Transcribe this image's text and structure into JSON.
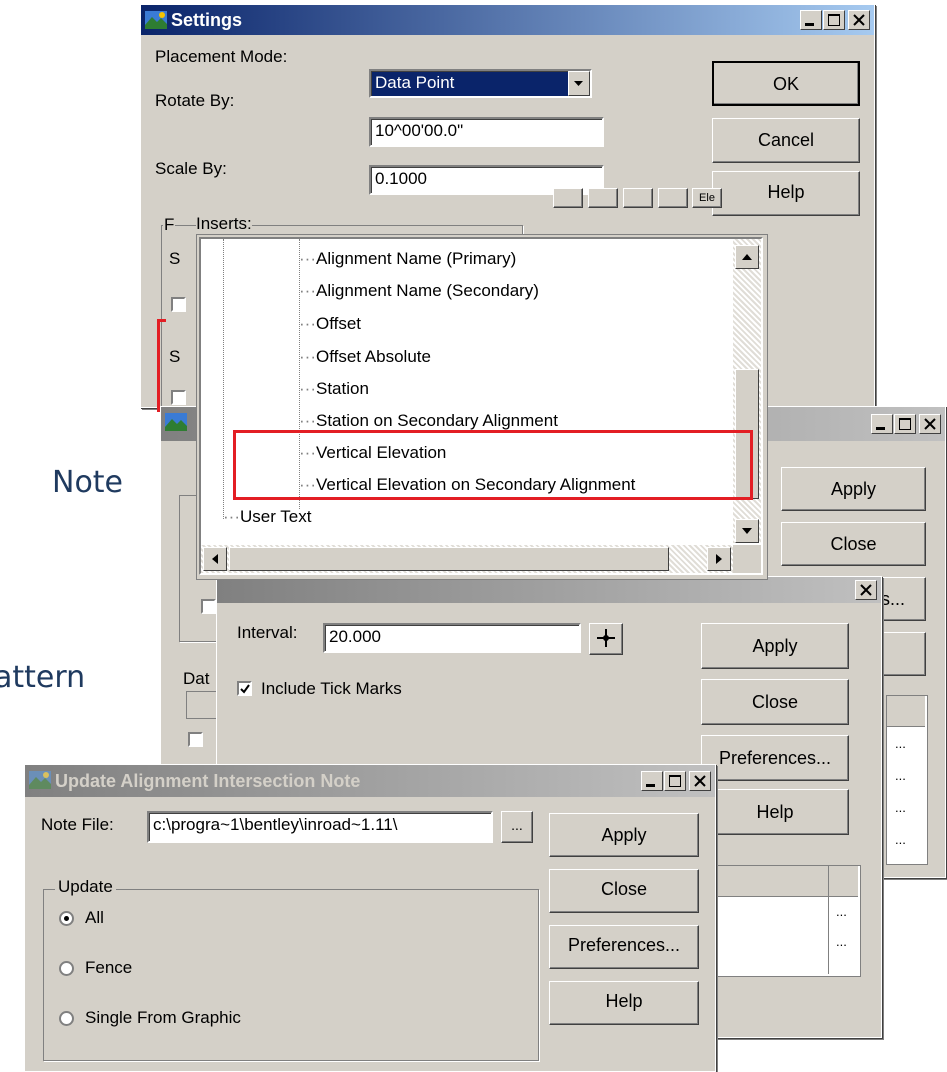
{
  "slide": {
    "note_text": "Note",
    "pattern_text": "attern"
  },
  "settings": {
    "title": "Settings",
    "placement_label": "Placement Mode:",
    "placement_value": "Data Point",
    "rotate_label": "Rotate By:",
    "rotate_value": "10^00'00.0\"",
    "scale_label": "Scale By:",
    "scale_value": "0.1000",
    "ok": "OK",
    "cancel": "Cancel",
    "help": "Help",
    "ele_label": "Ele",
    "inserts_label": "Inserts:",
    "group_letter": "F",
    "side_s1": "S",
    "side_s2": "S"
  },
  "inserts_list": {
    "items": [
      "Alignment Name (Primary)",
      "Alignment Name (Secondary)",
      "Offset",
      "Offset Absolute",
      "Station",
      "Station on Secondary Alignment",
      "Vertical Elevation",
      "Vertical Elevation on Secondary Alignment"
    ],
    "parent_item": "User Text"
  },
  "mid_window": {
    "apply": "Apply",
    "close": "Close",
    "preferences_partial": "s...",
    "dat_label": "Dat",
    "ellipsis": "..."
  },
  "tick_window": {
    "interval_label": "Interval:",
    "interval_value": "20.000",
    "include_ticks": "Include Tick Marks",
    "apply": "Apply",
    "close": "Close",
    "preferences": "Preferences...",
    "help": "Help",
    "ellipsis": "..."
  },
  "update_window": {
    "title": "Update Alignment Intersection Note",
    "note_file_label": "Note File:",
    "note_file_value": "c:\\progra~1\\bentley\\inroad~1.11\\",
    "browse": "...",
    "apply": "Apply",
    "close": "Close",
    "preferences": "Preferences...",
    "help": "Help",
    "update_group": "Update",
    "opt_all": "All",
    "opt_fence": "Fence",
    "opt_single": "Single From Graphic"
  },
  "colors": {
    "title_active": "#0a246a",
    "highlight_box": "#e31e24",
    "slide_text": "#1f3a5f"
  }
}
